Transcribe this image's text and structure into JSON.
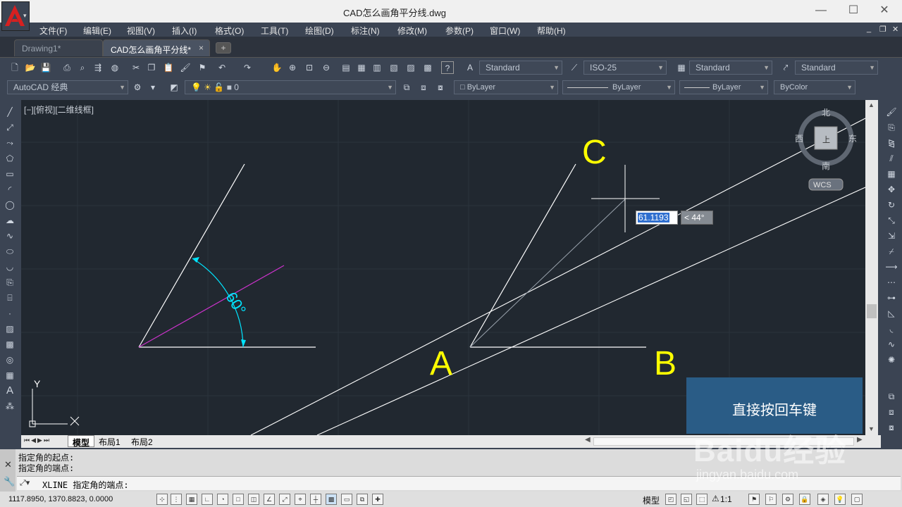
{
  "window": {
    "title": "CAD怎么画角平分线.dwg",
    "minimize_glyph": "—",
    "maximize_glyph": "☐",
    "close_glyph": "✕",
    "app_icon": "autocad-logo-icon",
    "app_letter": "A"
  },
  "menu": [
    "文件(F)",
    "编辑(E)",
    "视图(V)",
    "插入(I)",
    "格式(O)",
    "工具(T)",
    "绘图(D)",
    "标注(N)",
    "修改(M)",
    "参数(P)",
    "窗口(W)",
    "帮助(H)"
  ],
  "doc_tabs": [
    {
      "label": "Drawing1*",
      "active": false
    },
    {
      "label": "CAD怎么画角平分线*",
      "active": true
    }
  ],
  "tab_close_glyph": "×",
  "toolbar_styles": {
    "text_style": "Standard",
    "dim_style": "ISO-25",
    "table_style": "Standard",
    "multileader_style": "Standard"
  },
  "toolbar_props": {
    "workspace": "AutoCAD 经典",
    "layer": "0",
    "color": "ByLayer",
    "linetype": "ByLayer",
    "lineweight": "ByLayer",
    "plotstyle": "ByColor"
  },
  "viewport_label": "[−][俯视][二维线框]",
  "viewcube": {
    "north": "北",
    "south": "南",
    "east": "东",
    "west": "西",
    "top_face": "上",
    "wcs": "WCS"
  },
  "drawing": {
    "angle_label": "60°",
    "point_labels": {
      "a": "A",
      "b": "B",
      "c": "C"
    },
    "ucs_y": "Y",
    "ucs_x": "X"
  },
  "dynamic_input": {
    "length_value": "61.1193",
    "angle_value": "< 44°"
  },
  "layout_tabs": [
    "模型",
    "布局1",
    "布局2"
  ],
  "command_history": [
    "指定角的起点:",
    "指定角的端点:"
  ],
  "command_prompt": "XLINE 指定角的端点:",
  "coordinates": "1117.8950,  1370.8823,  0.0000",
  "status_right": {
    "model": "模型",
    "scale": "1:1"
  },
  "overlay_text": "直接按回车键",
  "watermark": {
    "brand": "Baidu经验",
    "url": "jingyan.baidu.com"
  },
  "colors": {
    "canvas": "#212830",
    "bisector": "#cc33cc",
    "dimension": "#00e5ff",
    "labels": "#ffff00",
    "overlay": "#2a5c86"
  }
}
